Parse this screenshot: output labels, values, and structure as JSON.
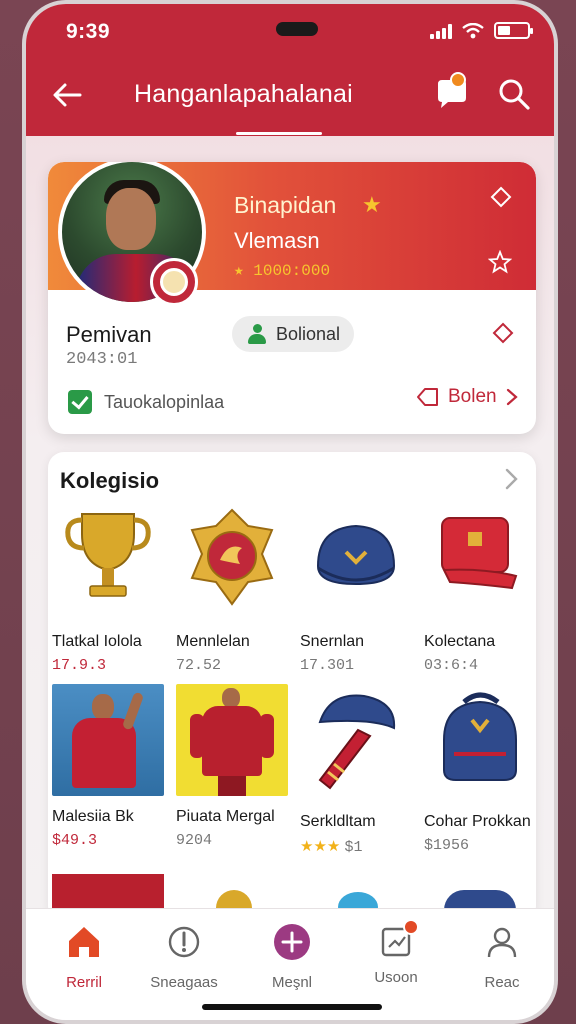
{
  "status_bar": {
    "time": "9:39",
    "signal_icon": "signal-icon",
    "wifi_icon": "wifi-icon",
    "battery_icon": "battery-icon"
  },
  "header": {
    "title": "Hanganlapahalanai",
    "back_icon": "back-arrow-icon",
    "chat_icon": "chat-icon",
    "search_icon": "search-icon",
    "accent": "#c0283a"
  },
  "profile": {
    "banner_name": "Binapidan",
    "banner_subtitle": "Vlemasn",
    "banner_rating": "★ 1000:000",
    "label": "Pemivan",
    "id": "2043:01",
    "status": "Bolional",
    "verified_text": "Tauokalopinlaa",
    "follow_label": "Bolen"
  },
  "collection": {
    "title": "Kolegisio",
    "items": [
      {
        "name": "Tlatkal Iolola",
        "sub": "17.9.3",
        "sub_style": "red",
        "icon": "trophy-icon"
      },
      {
        "name": "Mennlelan",
        "sub": "72.52",
        "icon": "medal-icon"
      },
      {
        "name": "Snernlan",
        "sub": "17.301",
        "icon": "cap-icon"
      },
      {
        "name": "Kolectana",
        "sub": "03:6:4",
        "icon": "bag-icon"
      },
      {
        "name": "Malesiia Bk",
        "sub": "$49.3",
        "sub_style": "red",
        "icon": "player-photo-icon"
      },
      {
        "name": "Piuata Mergal",
        "sub": "9204",
        "icon": "jersey-icon"
      },
      {
        "name": "Serkldltam",
        "stars": "★★★",
        "sub": "$1",
        "icon": "cap-scarf-icon"
      },
      {
        "name": "Cohar Prokkan",
        "sub": "$1956",
        "icon": "backpack-icon"
      }
    ]
  },
  "bottom_nav": [
    {
      "label": "Rerril",
      "icon": "home-icon",
      "active": true
    },
    {
      "label": "Sneagaas",
      "icon": "alert-icon"
    },
    {
      "label": "Meşnl",
      "icon": "plus-icon"
    },
    {
      "label": "Usoon",
      "icon": "notes-icon"
    },
    {
      "label": "Reac",
      "icon": "profile-icon"
    }
  ]
}
